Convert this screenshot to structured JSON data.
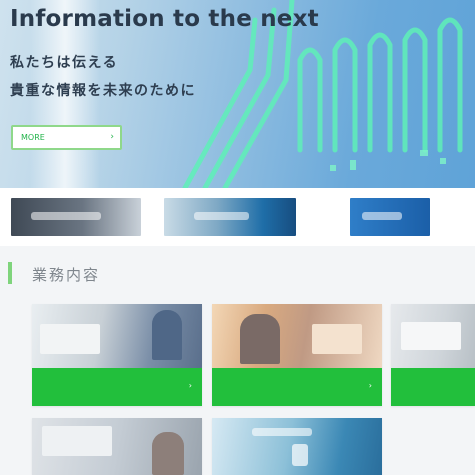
{
  "hero": {
    "title": "Information to the next",
    "subtitle_line1": "私たちは伝える",
    "subtitle_line2": "貴重な情報を未来のために",
    "button_label": "MORE",
    "button_arrow": "›"
  },
  "banners": [
    {
      "name": "banner-1"
    },
    {
      "name": "banner-2"
    },
    {
      "name": "banner-3"
    }
  ],
  "section": {
    "title": "業務内容"
  },
  "cards": [
    {
      "label": "",
      "arrow": "›"
    },
    {
      "label": "",
      "arrow": "›"
    },
    {
      "label": "",
      "arrow": "›"
    },
    {
      "label": "",
      "arrow": "›"
    },
    {
      "label": "",
      "arrow": "›"
    }
  ],
  "colors": {
    "accent_green": "#22bf3c",
    "hero_blue": "#6aa9da",
    "title_dark": "#2a3a4c"
  }
}
